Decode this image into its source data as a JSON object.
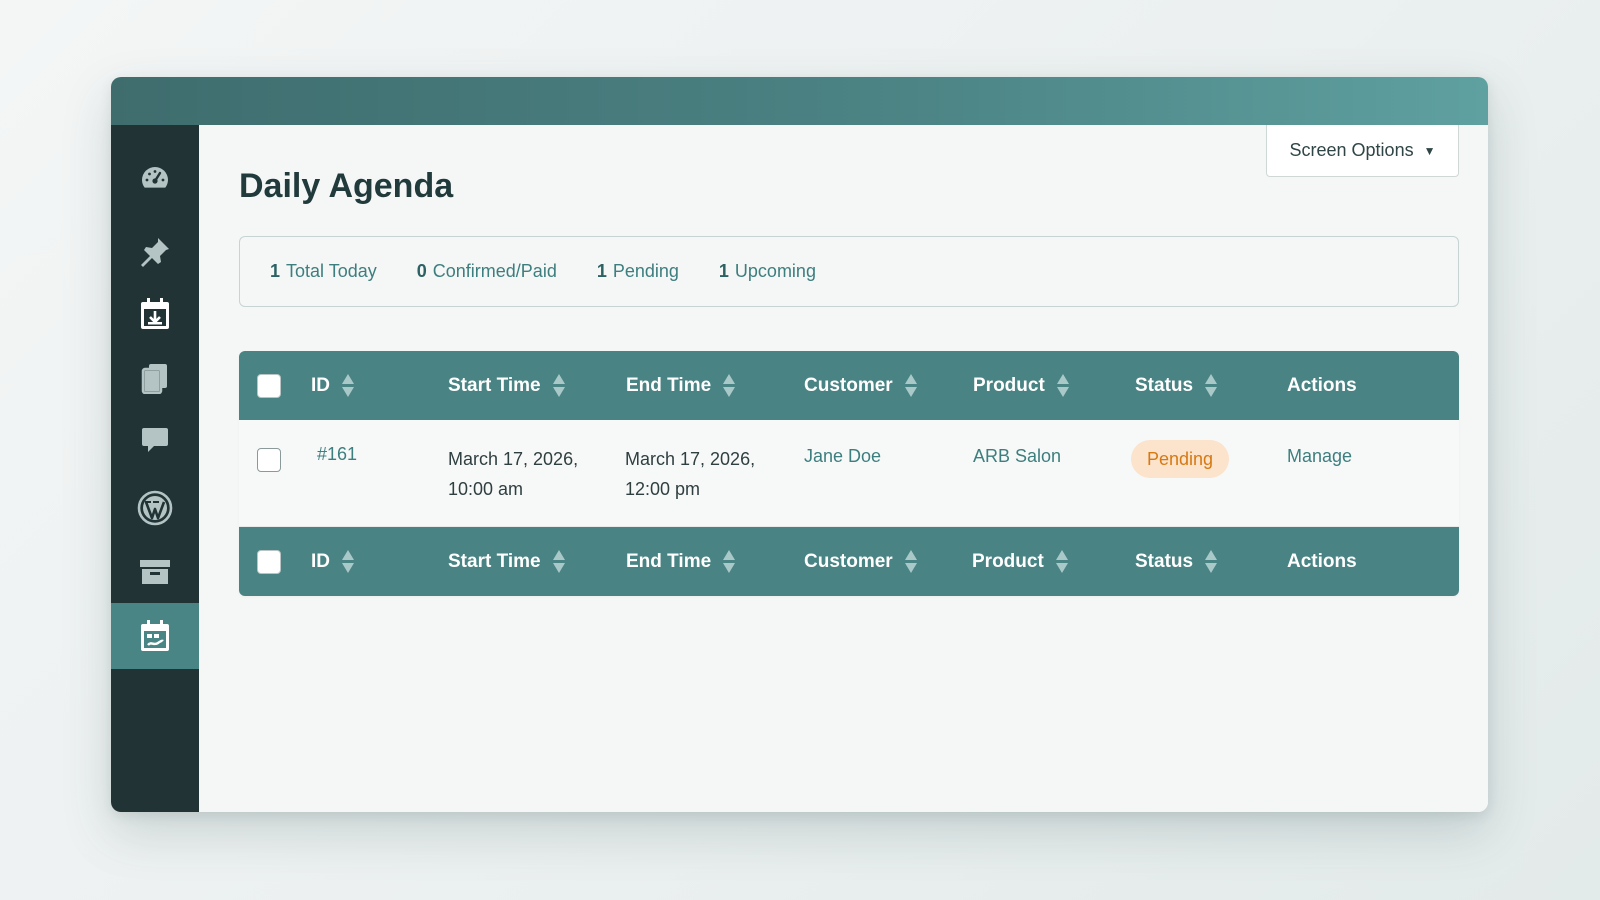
{
  "page": {
    "title": "Daily Agenda",
    "screen_options_label": "Screen Options"
  },
  "sidebar": {
    "items": [
      {
        "icon": "dashboard-icon"
      },
      {
        "icon": "pin-icon"
      },
      {
        "icon": "calendar-download-icon"
      },
      {
        "icon": "pages-icon"
      },
      {
        "icon": "comment-icon"
      },
      {
        "icon": "wordpress-icon"
      },
      {
        "icon": "archive-icon"
      },
      {
        "icon": "calendar-active-icon",
        "active": true
      }
    ]
  },
  "stats": [
    {
      "count": "1",
      "label": "Total Today"
    },
    {
      "count": "0",
      "label": "Confirmed/Paid"
    },
    {
      "count": "1",
      "label": "Pending"
    },
    {
      "count": "1",
      "label": "Upcoming"
    }
  ],
  "table": {
    "columns": [
      "ID",
      "Start Time",
      "End Time",
      "Customer",
      "Product",
      "Status",
      "Actions"
    ],
    "rows": [
      {
        "id": "#161",
        "start_date": "March 17, 2026,",
        "start_time": "10:00 am",
        "end_date": "March 17, 2026,",
        "end_time": "12:00 pm",
        "customer": "Jane Doe",
        "product": "ARB Salon",
        "status": "Pending",
        "action": "Manage"
      }
    ]
  },
  "colors": {
    "accent": "#4a8383",
    "sidebar": "#223335",
    "pending_bg": "#fbe3cc",
    "pending_text": "#d77912"
  }
}
